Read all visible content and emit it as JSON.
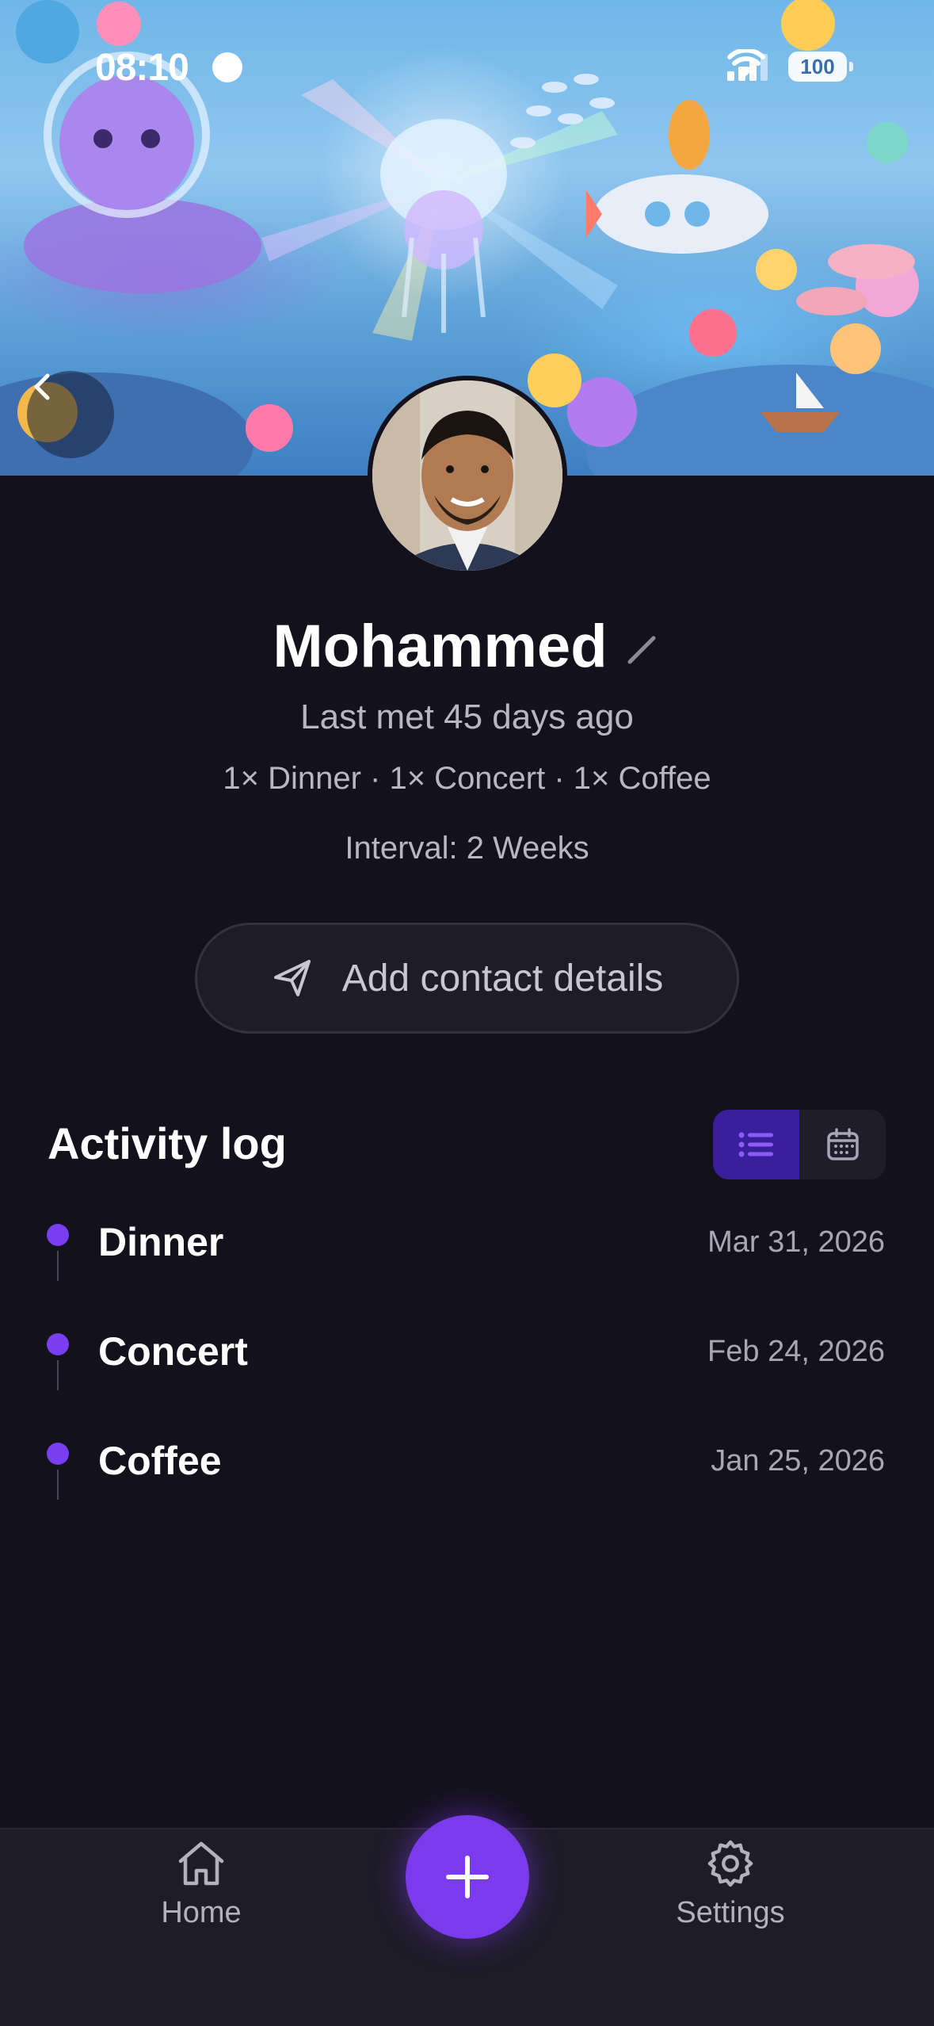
{
  "status_bar": {
    "time": "08:10",
    "battery": "100"
  },
  "profile": {
    "name": "Mohammed",
    "last_met": "Last met 45 days ago",
    "activity_counts": "1× Dinner · 1× Concert · 1× Coffee",
    "interval": "Interval: 2 Weeks",
    "add_contact_label": "Add contact details"
  },
  "activity_log": {
    "title": "Activity log",
    "view_mode": "list",
    "items": [
      {
        "title": "Dinner",
        "date": "Mar 31, 2026"
      },
      {
        "title": "Concert",
        "date": "Feb 24, 2026"
      },
      {
        "title": "Coffee",
        "date": "Jan 25, 2026"
      }
    ]
  },
  "bottom_nav": {
    "home_label": "Home",
    "settings_label": "Settings"
  },
  "colors": {
    "background": "#13111c",
    "accent": "#7c3aed",
    "timeline_dot": "#7b3df0",
    "toggle_active": "#3a1f9a"
  },
  "icons": {
    "back": "chevron-left-icon",
    "edit": "pencil-icon",
    "send": "paper-plane-icon",
    "list_view": "list-icon",
    "calendar_view": "calendar-icon",
    "home": "home-icon",
    "add": "plus-icon",
    "settings": "gear-icon"
  }
}
